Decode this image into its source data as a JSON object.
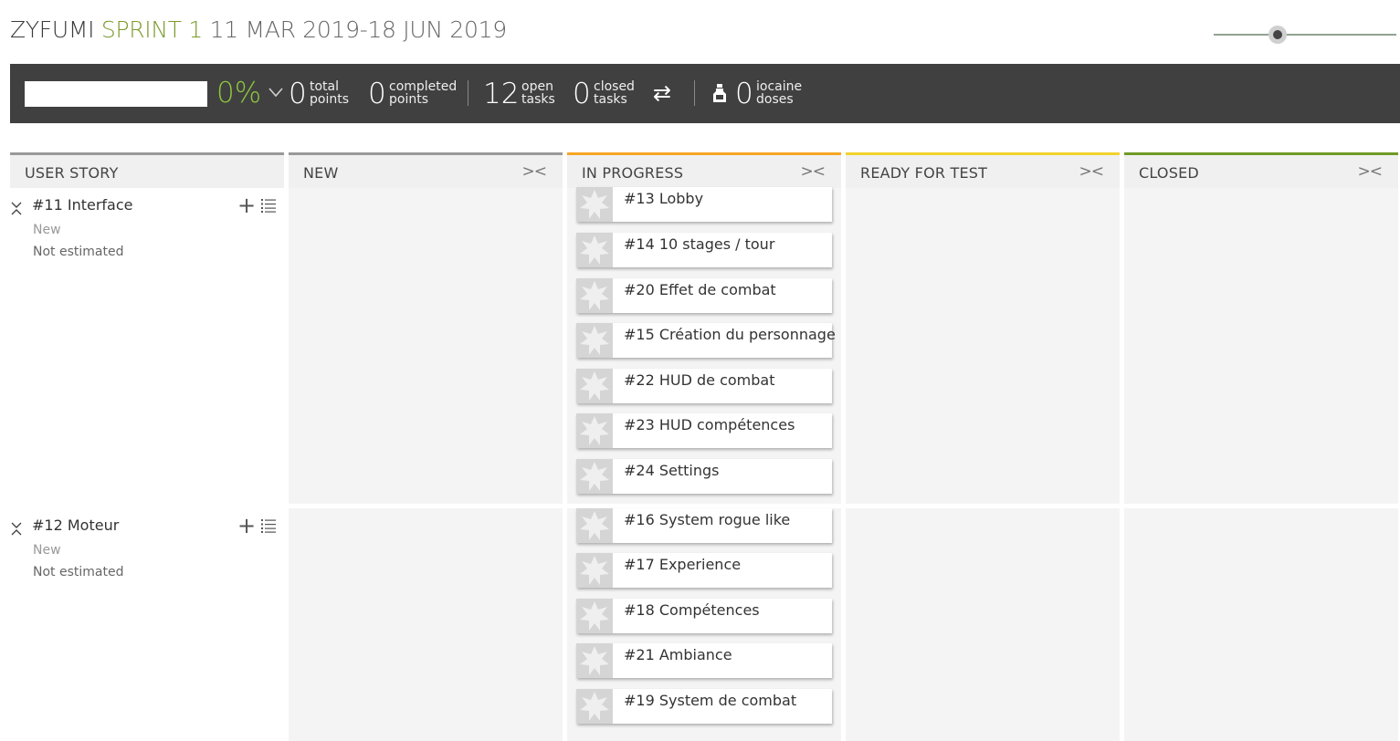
{
  "header": {
    "project": "ZYFUMI",
    "sprint": "SPRINT 1",
    "dates": "11 MAR 2019-18 JUN 2019"
  },
  "stats": {
    "percent": "0%",
    "total_points": {
      "value": "0",
      "label_top": "total",
      "label_bottom": "points"
    },
    "completed_points": {
      "value": "0",
      "label_top": "completed",
      "label_bottom": "points"
    },
    "open_tasks": {
      "value": "12",
      "label_top": "open",
      "label_bottom": "tasks"
    },
    "closed_tasks": {
      "value": "0",
      "label_top": "closed",
      "label_bottom": "tasks"
    },
    "iocaine": {
      "value": "0",
      "label_top": "iocaine",
      "label_bottom": "doses"
    },
    "swap_icon": "⇄"
  },
  "columns": {
    "user_story": "USER STORY",
    "new": "NEW",
    "in_progress": "IN PROGRESS",
    "ready_for_test": "READY FOR TEST",
    "closed": "CLOSED",
    "fold_symbol": "><"
  },
  "colors": {
    "new": "#999999",
    "in_progress": "#f5a623",
    "ready_for_test": "#f2d22e",
    "closed": "#6f9a26",
    "user_story": "#999999",
    "sprint": "#7b9a2c",
    "percent": "#8dc63f"
  },
  "stories": [
    {
      "title": "#11 Interface",
      "status": "New",
      "estimate": "Not estimated",
      "tasks": [
        "#13 Lobby",
        "#14 10 stages / tour",
        "#20 Effet de combat",
        "#15 Création du personnage",
        "#22 HUD de combat",
        "#23 HUD compétences",
        "#24 Settings"
      ]
    },
    {
      "title": "#12 Moteur",
      "status": "New",
      "estimate": "Not estimated",
      "tasks": [
        "#16 System rogue like",
        "#17 Experience",
        "#18 Compétences",
        "#21 Ambiance",
        "#19 System de combat"
      ]
    }
  ]
}
